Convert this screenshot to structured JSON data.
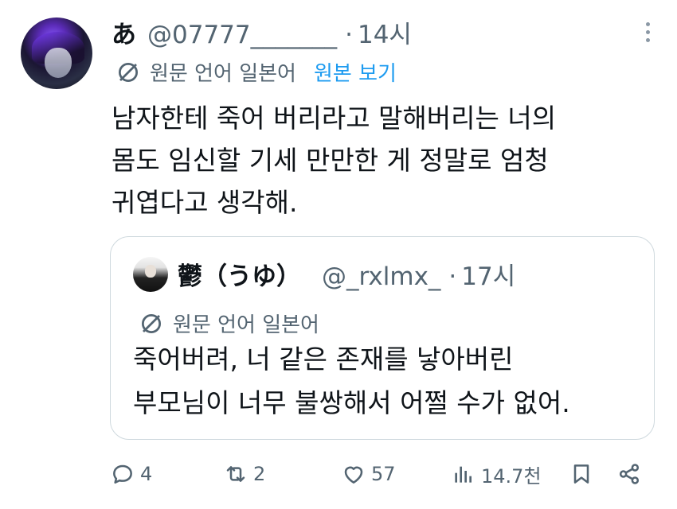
{
  "tweet": {
    "author_name": "あ",
    "handle": "@07777_______",
    "separator": "·",
    "time": "14시",
    "translate_label": "원문 언어 일본어",
    "show_original": "원본 보기",
    "body_lines": [
      "남자한테 죽어 버리라고 말해버리는 너의",
      "몸도 임신할 기세 만만한 게 정말로 엄청",
      "귀엽다고 생각해."
    ]
  },
  "quote": {
    "author_name": "鬱（うゆ）",
    "handle": "@_rxlmx_",
    "separator": "·",
    "time": "17시",
    "translate_label": "원문 언어 일본어",
    "body_lines": [
      "죽어버려, 너 같은 존재를 낳아버린",
      "부모님이 너무 불쌍해서 어쩔 수가 없어."
    ]
  },
  "actions": {
    "reply_count": "4",
    "retweet_count": "2",
    "like_count": "57",
    "view_count": "14.7천"
  },
  "icons": {
    "more": "more-vertical-icon",
    "translate": "globe-icon",
    "reply": "reply-icon",
    "retweet": "retweet-icon",
    "like": "heart-icon",
    "views": "views-icon",
    "bookmark": "bookmark-icon",
    "share": "share-icon"
  },
  "colors": {
    "text": "#0f1419",
    "secondary": "#536471",
    "link": "#1d9bf0",
    "border": "#cfd9de"
  }
}
